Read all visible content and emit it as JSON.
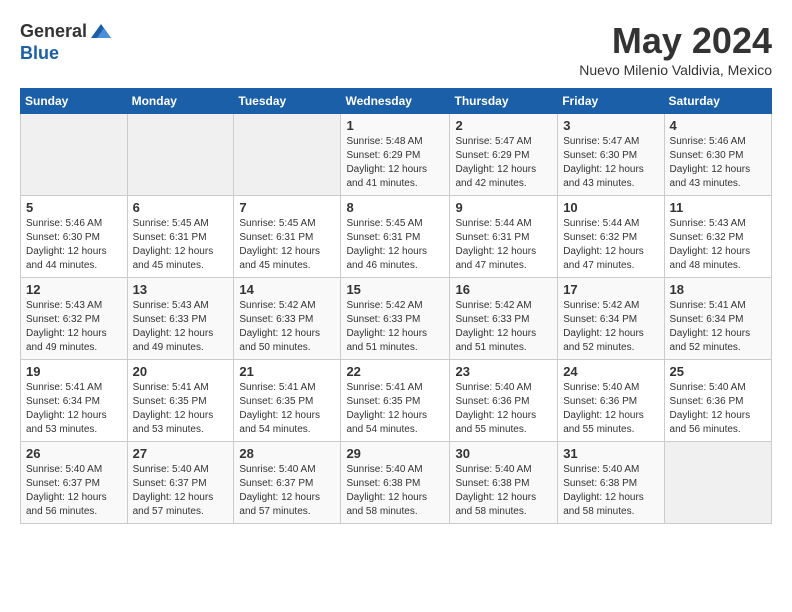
{
  "logo": {
    "general": "General",
    "blue": "Blue"
  },
  "title": "May 2024",
  "location": "Nuevo Milenio Valdivia, Mexico",
  "days_of_week": [
    "Sunday",
    "Monday",
    "Tuesday",
    "Wednesday",
    "Thursday",
    "Friday",
    "Saturday"
  ],
  "weeks": [
    [
      {
        "day": "",
        "info": ""
      },
      {
        "day": "",
        "info": ""
      },
      {
        "day": "",
        "info": ""
      },
      {
        "day": "1",
        "info": "Sunrise: 5:48 AM\nSunset: 6:29 PM\nDaylight: 12 hours\nand 41 minutes."
      },
      {
        "day": "2",
        "info": "Sunrise: 5:47 AM\nSunset: 6:29 PM\nDaylight: 12 hours\nand 42 minutes."
      },
      {
        "day": "3",
        "info": "Sunrise: 5:47 AM\nSunset: 6:30 PM\nDaylight: 12 hours\nand 43 minutes."
      },
      {
        "day": "4",
        "info": "Sunrise: 5:46 AM\nSunset: 6:30 PM\nDaylight: 12 hours\nand 43 minutes."
      }
    ],
    [
      {
        "day": "5",
        "info": "Sunrise: 5:46 AM\nSunset: 6:30 PM\nDaylight: 12 hours\nand 44 minutes."
      },
      {
        "day": "6",
        "info": "Sunrise: 5:45 AM\nSunset: 6:31 PM\nDaylight: 12 hours\nand 45 minutes."
      },
      {
        "day": "7",
        "info": "Sunrise: 5:45 AM\nSunset: 6:31 PM\nDaylight: 12 hours\nand 45 minutes."
      },
      {
        "day": "8",
        "info": "Sunrise: 5:45 AM\nSunset: 6:31 PM\nDaylight: 12 hours\nand 46 minutes."
      },
      {
        "day": "9",
        "info": "Sunrise: 5:44 AM\nSunset: 6:31 PM\nDaylight: 12 hours\nand 47 minutes."
      },
      {
        "day": "10",
        "info": "Sunrise: 5:44 AM\nSunset: 6:32 PM\nDaylight: 12 hours\nand 47 minutes."
      },
      {
        "day": "11",
        "info": "Sunrise: 5:43 AM\nSunset: 6:32 PM\nDaylight: 12 hours\nand 48 minutes."
      }
    ],
    [
      {
        "day": "12",
        "info": "Sunrise: 5:43 AM\nSunset: 6:32 PM\nDaylight: 12 hours\nand 49 minutes."
      },
      {
        "day": "13",
        "info": "Sunrise: 5:43 AM\nSunset: 6:33 PM\nDaylight: 12 hours\nand 49 minutes."
      },
      {
        "day": "14",
        "info": "Sunrise: 5:42 AM\nSunset: 6:33 PM\nDaylight: 12 hours\nand 50 minutes."
      },
      {
        "day": "15",
        "info": "Sunrise: 5:42 AM\nSunset: 6:33 PM\nDaylight: 12 hours\nand 51 minutes."
      },
      {
        "day": "16",
        "info": "Sunrise: 5:42 AM\nSunset: 6:33 PM\nDaylight: 12 hours\nand 51 minutes."
      },
      {
        "day": "17",
        "info": "Sunrise: 5:42 AM\nSunset: 6:34 PM\nDaylight: 12 hours\nand 52 minutes."
      },
      {
        "day": "18",
        "info": "Sunrise: 5:41 AM\nSunset: 6:34 PM\nDaylight: 12 hours\nand 52 minutes."
      }
    ],
    [
      {
        "day": "19",
        "info": "Sunrise: 5:41 AM\nSunset: 6:34 PM\nDaylight: 12 hours\nand 53 minutes."
      },
      {
        "day": "20",
        "info": "Sunrise: 5:41 AM\nSunset: 6:35 PM\nDaylight: 12 hours\nand 53 minutes."
      },
      {
        "day": "21",
        "info": "Sunrise: 5:41 AM\nSunset: 6:35 PM\nDaylight: 12 hours\nand 54 minutes."
      },
      {
        "day": "22",
        "info": "Sunrise: 5:41 AM\nSunset: 6:35 PM\nDaylight: 12 hours\nand 54 minutes."
      },
      {
        "day": "23",
        "info": "Sunrise: 5:40 AM\nSunset: 6:36 PM\nDaylight: 12 hours\nand 55 minutes."
      },
      {
        "day": "24",
        "info": "Sunrise: 5:40 AM\nSunset: 6:36 PM\nDaylight: 12 hours\nand 55 minutes."
      },
      {
        "day": "25",
        "info": "Sunrise: 5:40 AM\nSunset: 6:36 PM\nDaylight: 12 hours\nand 56 minutes."
      }
    ],
    [
      {
        "day": "26",
        "info": "Sunrise: 5:40 AM\nSunset: 6:37 PM\nDaylight: 12 hours\nand 56 minutes."
      },
      {
        "day": "27",
        "info": "Sunrise: 5:40 AM\nSunset: 6:37 PM\nDaylight: 12 hours\nand 57 minutes."
      },
      {
        "day": "28",
        "info": "Sunrise: 5:40 AM\nSunset: 6:37 PM\nDaylight: 12 hours\nand 57 minutes."
      },
      {
        "day": "29",
        "info": "Sunrise: 5:40 AM\nSunset: 6:38 PM\nDaylight: 12 hours\nand 58 minutes."
      },
      {
        "day": "30",
        "info": "Sunrise: 5:40 AM\nSunset: 6:38 PM\nDaylight: 12 hours\nand 58 minutes."
      },
      {
        "day": "31",
        "info": "Sunrise: 5:40 AM\nSunset: 6:38 PM\nDaylight: 12 hours\nand 58 minutes."
      },
      {
        "day": "",
        "info": ""
      }
    ]
  ]
}
